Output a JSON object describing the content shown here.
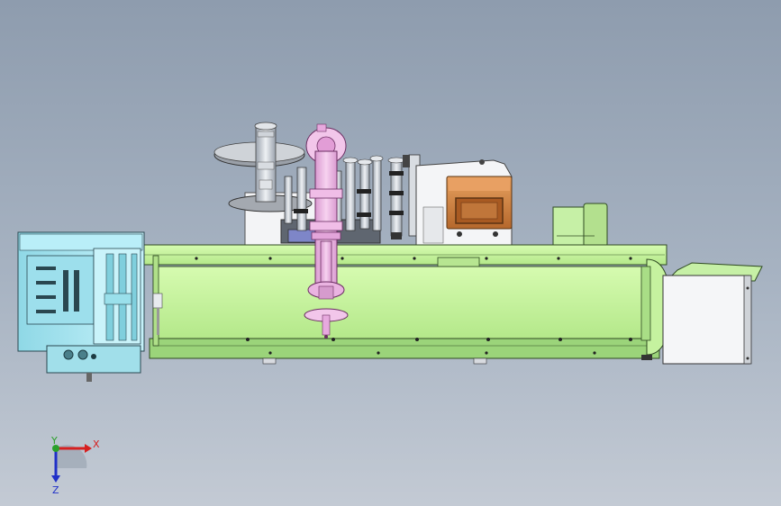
{
  "view": {
    "background_top": "#8e9cae",
    "background_bottom": "#c3cad4"
  },
  "triad": {
    "x_label": "X",
    "y_label": "Y",
    "z_label": "Z",
    "x_color": "#d62020",
    "y_color": "#2aa02a",
    "z_color": "#2030c8"
  },
  "parts": {
    "conveyor_color": "#c9f79f",
    "feeder_color": "#a6e9f4",
    "spindle_color": "#f0b8e6",
    "control_box_color": "#c97a3c",
    "motor_color": "#c6f0a6",
    "outfeed_color": "#c6f0a6"
  }
}
